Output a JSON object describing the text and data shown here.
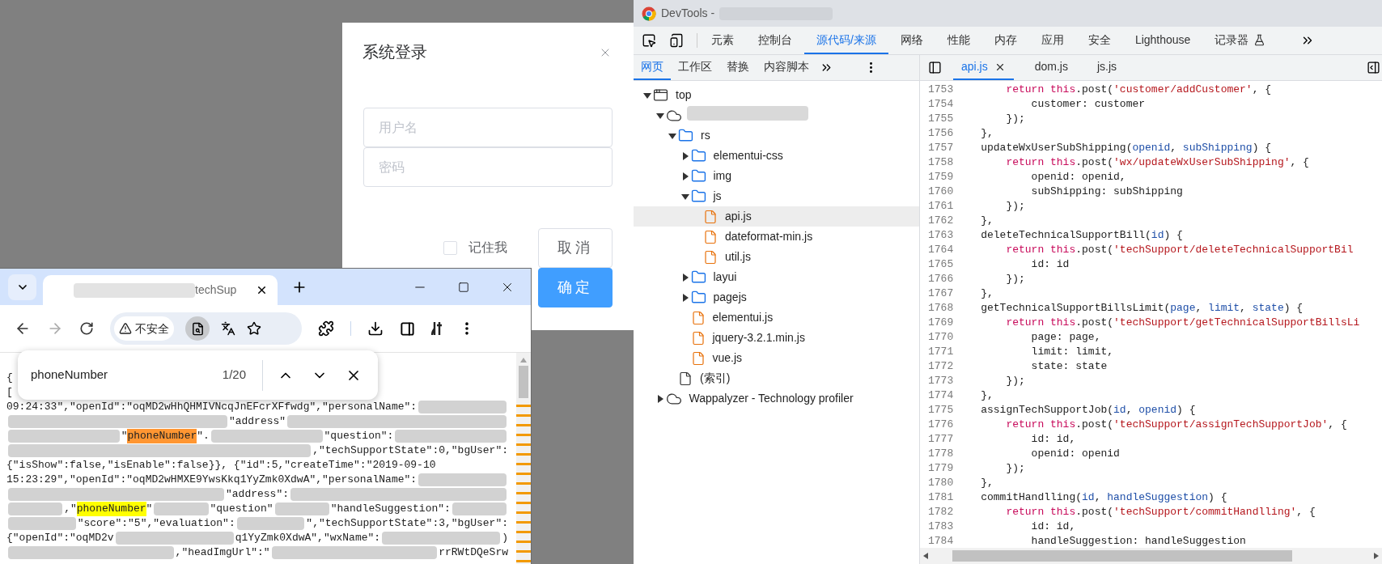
{
  "login_dialog": {
    "title": "系统登录",
    "username": {
      "placeholder": "用户名"
    },
    "password": {
      "placeholder": "密码"
    },
    "remember": {
      "label": "记住我",
      "checked": false
    },
    "buttons": [
      {
        "label": "取消",
        "kind": "secondary"
      },
      {
        "label": "确定",
        "kind": "primary"
      }
    ]
  },
  "browser": {
    "tab": {
      "title": "techSup",
      "redacted_prefix": true
    },
    "address": {
      "security_label": "不安全"
    },
    "find_bar": {
      "value": "phoneNumber",
      "count": "1/20"
    },
    "content_lines": [
      {
        "segments": [
          {
            "kind": "text",
            "text": "{"
          }
        ]
      },
      {
        "segments": [
          {
            "kind": "text",
            "text": "["
          }
        ]
      },
      {
        "segments": [
          {
            "kind": "text",
            "text": "09:24:33\",\"openId\":\"oqMD2wHhQHMIVNcqJnEFcrXFfwdg\",\"personalName\":"
          },
          {
            "kind": "redacted"
          }
        ]
      },
      {
        "segments": [
          {
            "kind": "redacted"
          },
          {
            "kind": "text",
            "text": "\"address\""
          },
          {
            "kind": "redacted"
          }
        ]
      },
      {
        "segments": [
          {
            "kind": "redacted"
          },
          {
            "kind": "text",
            "text": "\""
          },
          {
            "kind": "match",
            "text": "phoneNumber",
            "selected": true
          },
          {
            "kind": "text",
            "text": "\"."
          },
          {
            "kind": "redacted"
          },
          {
            "kind": "text",
            "text": "\"question\":"
          },
          {
            "kind": "redacted"
          }
        ]
      },
      {
        "segments": [
          {
            "kind": "redacted"
          },
          {
            "kind": "text",
            "text": ",\"techSupportState\":0,\"bgUser\":"
          }
        ]
      },
      {
        "segments": [
          {
            "kind": "text",
            "text": "{\"isShow\":false,\"isEnable\":false}}, {\"id\":5,\"createTime\":\"2019-09-10"
          }
        ]
      },
      {
        "segments": [
          {
            "kind": "text",
            "text": "15:23:29\",\"openId\":\"oqMD2wHMXE9YwsKkq1YyZmk0XdwA\",\"personalName\":"
          },
          {
            "kind": "redacted"
          }
        ]
      },
      {
        "segments": [
          {
            "kind": "redacted"
          },
          {
            "kind": "text",
            "text": "\"address\":"
          },
          {
            "kind": "redacted"
          }
        ]
      },
      {
        "segments": [
          {
            "kind": "redacted"
          },
          {
            "kind": "text",
            "text": ",\""
          },
          {
            "kind": "match",
            "text": "phoneNumber",
            "selected": false
          },
          {
            "kind": "text",
            "text": "\""
          },
          {
            "kind": "redacted"
          },
          {
            "kind": "text",
            "text": "\"question\""
          },
          {
            "kind": "redacted"
          },
          {
            "kind": "text",
            "text": "\"handleSuggestion\":"
          },
          {
            "kind": "redacted"
          }
        ]
      },
      {
        "segments": [
          {
            "kind": "redacted"
          },
          {
            "kind": "text",
            "text": "\"score\":\"5\",\"evaluation\":"
          },
          {
            "kind": "redacted"
          },
          {
            "kind": "text",
            "text": "\",\"techSupportState\":3,\"bgUser\":"
          }
        ]
      },
      {
        "segments": [
          {
            "kind": "text",
            "text": "{\"openId\":\"oqMD2v"
          },
          {
            "kind": "redacted"
          },
          {
            "kind": "text",
            "text": "q1YyZmk0XdwA\",\"wxName\":"
          },
          {
            "kind": "redacted"
          },
          {
            "kind": "text",
            "text": ")"
          }
        ]
      },
      {
        "segments": [
          {
            "kind": "redacted"
          },
          {
            "kind": "text",
            "text": ",\"headImgUrl\":\""
          },
          {
            "kind": "redacted"
          },
          {
            "kind": "text",
            "text": "rrRWtDQeSrw"
          }
        ]
      }
    ]
  },
  "devtools": {
    "title": "DevTools -",
    "title_redacted": true,
    "tabs": [
      {
        "label": "元素",
        "selected": false,
        "experimental": false
      },
      {
        "label": "控制台",
        "selected": false,
        "experimental": false
      },
      {
        "label": "源代码/来源",
        "selected": true,
        "experimental": false
      },
      {
        "label": "网络",
        "selected": false,
        "experimental": false
      },
      {
        "label": "性能",
        "selected": false,
        "experimental": false
      },
      {
        "label": "内存",
        "selected": false,
        "experimental": false
      },
      {
        "label": "应用",
        "selected": false,
        "experimental": false
      },
      {
        "label": "安全",
        "selected": false,
        "experimental": false
      },
      {
        "label": "Lighthouse",
        "selected": false,
        "experimental": false
      },
      {
        "label": "记录器",
        "selected": false,
        "experimental": true
      }
    ],
    "navigator_tabs": [
      {
        "label": "网页",
        "selected": true
      },
      {
        "label": "工作区",
        "selected": false
      },
      {
        "label": "替换",
        "selected": false
      },
      {
        "label": "内容脚本",
        "selected": false
      }
    ],
    "editor_tabs": [
      {
        "label": "api.js",
        "selected": true
      },
      {
        "label": "dom.js",
        "selected": false
      },
      {
        "label": "js.js",
        "selected": false
      }
    ],
    "tree": [
      {
        "kind": "frame",
        "label": "top",
        "expanded": true,
        "selected": false,
        "children": [
          {
            "kind": "cloud",
            "expanded": true,
            "selected": false,
            "children": [
              {
                "kind": "folder",
                "label": "rs",
                "expanded": true,
                "selected": false,
                "children": [
                  {
                    "kind": "folder",
                    "label": "elementui-css",
                    "expanded": false,
                    "selected": false
                  },
                  {
                    "kind": "folder",
                    "label": "img",
                    "expanded": false,
                    "selected": false
                  },
                  {
                    "kind": "folder",
                    "label": "js",
                    "expanded": true,
                    "selected": false,
                    "children": [
                      {
                        "kind": "script",
                        "label": "api.js",
                        "selected": true
                      },
                      {
                        "kind": "script",
                        "label": "dateformat-min.js",
                        "selected": false
                      },
                      {
                        "kind": "script",
                        "label": "util.js",
                        "selected": false
                      }
                    ]
                  },
                  {
                    "kind": "folder",
                    "label": "layui",
                    "expanded": false,
                    "selected": false
                  },
                  {
                    "kind": "folder",
                    "label": "pagejs",
                    "expanded": false,
                    "selected": false
                  },
                  {
                    "kind": "script",
                    "label": "elementui.js",
                    "selected": false
                  },
                  {
                    "kind": "script",
                    "label": "jquery-3.2.1.min.js",
                    "selected": false
                  },
                  {
                    "kind": "script",
                    "label": "vue.js",
                    "selected": false
                  }
                ]
              },
              {
                "kind": "document",
                "label": "(索引)",
                "selected": false
              }
            ]
          },
          {
            "kind": "cloud",
            "label": "Wappalyzer - Technology profiler",
            "expanded": false,
            "selected": false
          }
        ]
      }
    ],
    "code_lines": [
      {
        "number": "1753",
        "tokens": [
          {
            "kind": "keyword",
            "text": "        return this"
          },
          {
            "kind": "plain",
            "text": ".post("
          },
          {
            "kind": "string",
            "text": "'customer/addCustomer'"
          },
          {
            "kind": "plain",
            "text": ", {"
          }
        ]
      },
      {
        "number": "1754",
        "tokens": [
          {
            "kind": "plain",
            "text": "            customer: customer"
          }
        ]
      },
      {
        "number": "1755",
        "tokens": [
          {
            "kind": "plain",
            "text": "        });"
          }
        ]
      },
      {
        "number": "1756",
        "tokens": [
          {
            "kind": "plain",
            "text": "    },"
          }
        ]
      },
      {
        "number": "1757",
        "tokens": [
          {
            "kind": "plain",
            "text": "    updateWxUserSubShipping("
          },
          {
            "kind": "param",
            "text": "openid"
          },
          {
            "kind": "plain",
            "text": ", "
          },
          {
            "kind": "param",
            "text": "subShipping"
          },
          {
            "kind": "plain",
            "text": ") {"
          }
        ]
      },
      {
        "number": "1758",
        "tokens": [
          {
            "kind": "keyword",
            "text": "        return this"
          },
          {
            "kind": "plain",
            "text": ".post("
          },
          {
            "kind": "string",
            "text": "'wx/updateWxUserSubShipping'"
          },
          {
            "kind": "plain",
            "text": ", {"
          }
        ]
      },
      {
        "number": "1759",
        "tokens": [
          {
            "kind": "plain",
            "text": "            openid: openid,"
          }
        ]
      },
      {
        "number": "1760",
        "tokens": [
          {
            "kind": "plain",
            "text": "            subShipping: subShipping"
          }
        ]
      },
      {
        "number": "1761",
        "tokens": [
          {
            "kind": "plain",
            "text": "        });"
          }
        ]
      },
      {
        "number": "1762",
        "tokens": [
          {
            "kind": "plain",
            "text": "    },"
          }
        ]
      },
      {
        "number": "1763",
        "tokens": [
          {
            "kind": "plain",
            "text": "    deleteTechnicalSupportBill("
          },
          {
            "kind": "param",
            "text": "id"
          },
          {
            "kind": "plain",
            "text": ") {"
          }
        ]
      },
      {
        "number": "1764",
        "tokens": [
          {
            "kind": "keyword",
            "text": "        return this"
          },
          {
            "kind": "plain",
            "text": ".post("
          },
          {
            "kind": "string",
            "text": "'techSupport/deleteTechnicalSupportBil"
          }
        ]
      },
      {
        "number": "1765",
        "tokens": [
          {
            "kind": "plain",
            "text": "            id: id"
          }
        ]
      },
      {
        "number": "1766",
        "tokens": [
          {
            "kind": "plain",
            "text": "        });"
          }
        ]
      },
      {
        "number": "1767",
        "tokens": [
          {
            "kind": "plain",
            "text": "    },"
          }
        ]
      },
      {
        "number": "1768",
        "tokens": [
          {
            "kind": "plain",
            "text": "    getTechnicalSupportBillsLimit("
          },
          {
            "kind": "param",
            "text": "page"
          },
          {
            "kind": "plain",
            "text": ", "
          },
          {
            "kind": "param",
            "text": "limit"
          },
          {
            "kind": "plain",
            "text": ", "
          },
          {
            "kind": "param",
            "text": "state"
          },
          {
            "kind": "plain",
            "text": ") {"
          }
        ]
      },
      {
        "number": "1769",
        "tokens": [
          {
            "kind": "keyword",
            "text": "        return this"
          },
          {
            "kind": "plain",
            "text": ".post("
          },
          {
            "kind": "string",
            "text": "'techSupport/getTechnicalSupportBillsLi"
          }
        ]
      },
      {
        "number": "1770",
        "tokens": [
          {
            "kind": "plain",
            "text": "            page: page,"
          }
        ]
      },
      {
        "number": "1771",
        "tokens": [
          {
            "kind": "plain",
            "text": "            limit: limit,"
          }
        ]
      },
      {
        "number": "1772",
        "tokens": [
          {
            "kind": "plain",
            "text": "            state: state"
          }
        ]
      },
      {
        "number": "1773",
        "tokens": [
          {
            "kind": "plain",
            "text": "        });"
          }
        ]
      },
      {
        "number": "1774",
        "tokens": [
          {
            "kind": "plain",
            "text": "    },"
          }
        ]
      },
      {
        "number": "1775",
        "tokens": [
          {
            "kind": "plain",
            "text": "    assignTechSupportJob("
          },
          {
            "kind": "param",
            "text": "id"
          },
          {
            "kind": "plain",
            "text": ", "
          },
          {
            "kind": "param",
            "text": "openid"
          },
          {
            "kind": "plain",
            "text": ") {"
          }
        ]
      },
      {
        "number": "1776",
        "tokens": [
          {
            "kind": "keyword",
            "text": "        return this"
          },
          {
            "kind": "plain",
            "text": ".post("
          },
          {
            "kind": "string",
            "text": "'techSupport/assignTechSupportJob'"
          },
          {
            "kind": "plain",
            "text": ", {"
          }
        ]
      },
      {
        "number": "1777",
        "tokens": [
          {
            "kind": "plain",
            "text": "            id: id,"
          }
        ]
      },
      {
        "number": "1778",
        "tokens": [
          {
            "kind": "plain",
            "text": "            openid: openid"
          }
        ]
      },
      {
        "number": "1779",
        "tokens": [
          {
            "kind": "plain",
            "text": "        });"
          }
        ]
      },
      {
        "number": "1780",
        "tokens": [
          {
            "kind": "plain",
            "text": "    },"
          }
        ]
      },
      {
        "number": "1781",
        "tokens": [
          {
            "kind": "plain",
            "text": "    commitHandlling("
          },
          {
            "kind": "param",
            "text": "id"
          },
          {
            "kind": "plain",
            "text": ", "
          },
          {
            "kind": "param",
            "text": "handleSuggestion"
          },
          {
            "kind": "plain",
            "text": ") {"
          }
        ]
      },
      {
        "number": "1782",
        "tokens": [
          {
            "kind": "keyword",
            "text": "        return this"
          },
          {
            "kind": "plain",
            "text": ".post("
          },
          {
            "kind": "string",
            "text": "'techSupport/commitHandlling'"
          },
          {
            "kind": "plain",
            "text": ", {"
          }
        ]
      },
      {
        "number": "1783",
        "tokens": [
          {
            "kind": "plain",
            "text": "            id: id,"
          }
        ]
      },
      {
        "number": "1784",
        "tokens": [
          {
            "kind": "plain",
            "text": "            handleSuggestion: handleSuggestion"
          }
        ]
      }
    ]
  }
}
